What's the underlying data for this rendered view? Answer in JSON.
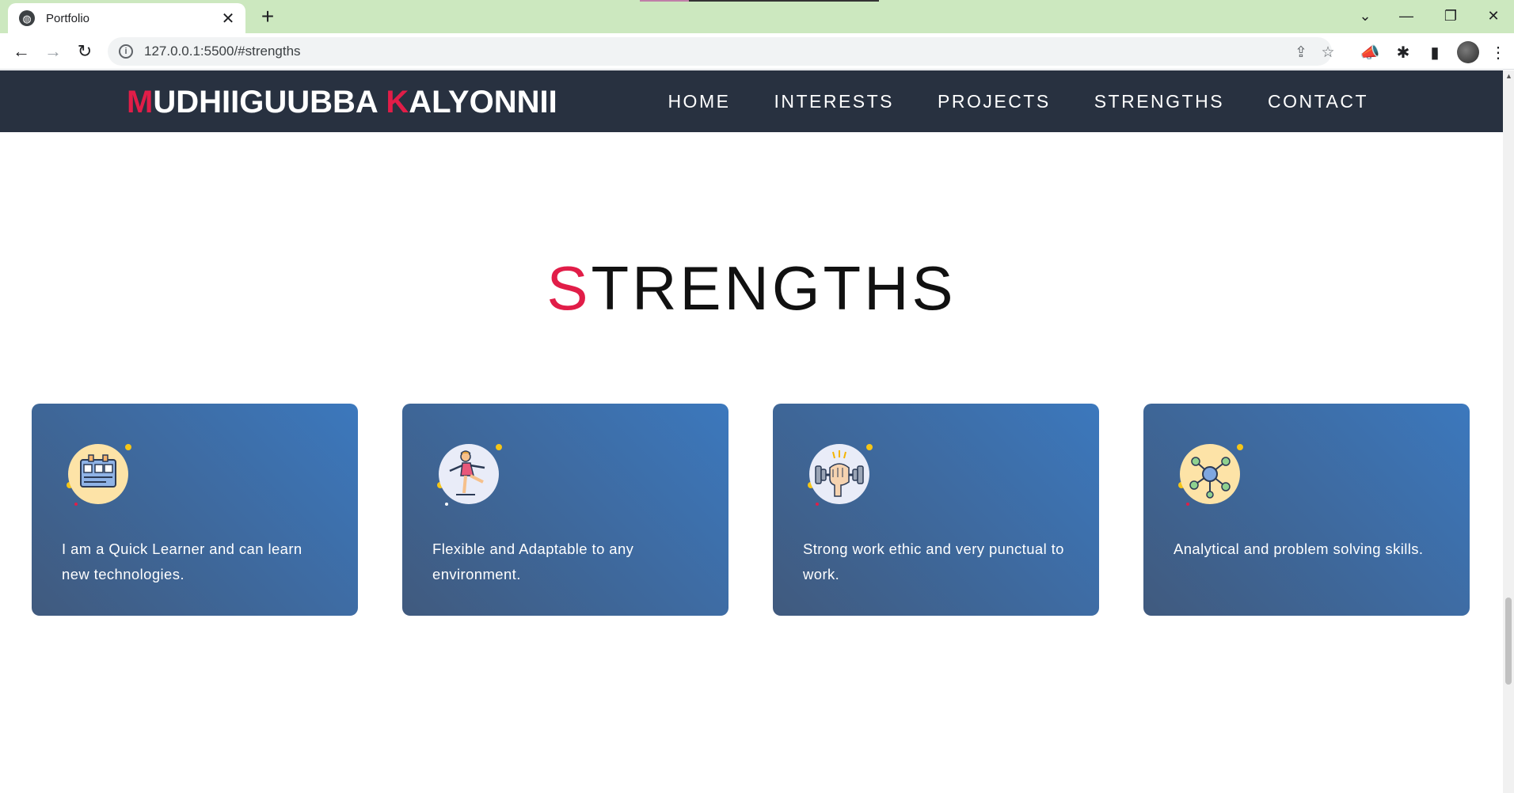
{
  "browser": {
    "tab_title": "Portfolio",
    "tab_close": "✕",
    "new_tab": "+",
    "url": "127.0.0.1:5500/#strengths",
    "controls": {
      "chevron": "⌄",
      "minimize": "—",
      "restore": "❐",
      "close": "✕"
    },
    "nav": {
      "back": "←",
      "forward": "→",
      "reload": "↻"
    },
    "omni_icons": {
      "share": "⇪",
      "star": "☆"
    },
    "extensions": {
      "announce": "📣",
      "puzzle": "✱",
      "sidepanel": "▮",
      "menu": "⋮"
    }
  },
  "site": {
    "logo": {
      "first_accent": "M",
      "first_rest": "UDHIIGUUBBA ",
      "last_accent": "K",
      "last_rest": "ALYONNII"
    },
    "menu": [
      "HOME",
      "INTERESTS",
      "PROJECTS",
      "STRENGTHS",
      "CONTACT"
    ]
  },
  "strengths": {
    "title_accent": "S",
    "title_rest": "TRENGTHS",
    "cards": [
      {
        "icon": "learning-board-icon",
        "text": "I am a Quick Learner and can learn new technologies."
      },
      {
        "icon": "gymnast-icon",
        "text": "Flexible and Adaptable to any environment."
      },
      {
        "icon": "dumbbell-fist-icon",
        "text": "Strong work ethic and very punctual to work."
      },
      {
        "icon": "network-nodes-icon",
        "text": "Analytical and problem solving skills."
      }
    ]
  },
  "colors": {
    "accent": "#e11d48",
    "nav_bg": "#283140",
    "card_gradient_start": "#405a7e",
    "card_gradient_end": "#3c78bd",
    "tabbar_bg": "#cce8bf"
  }
}
